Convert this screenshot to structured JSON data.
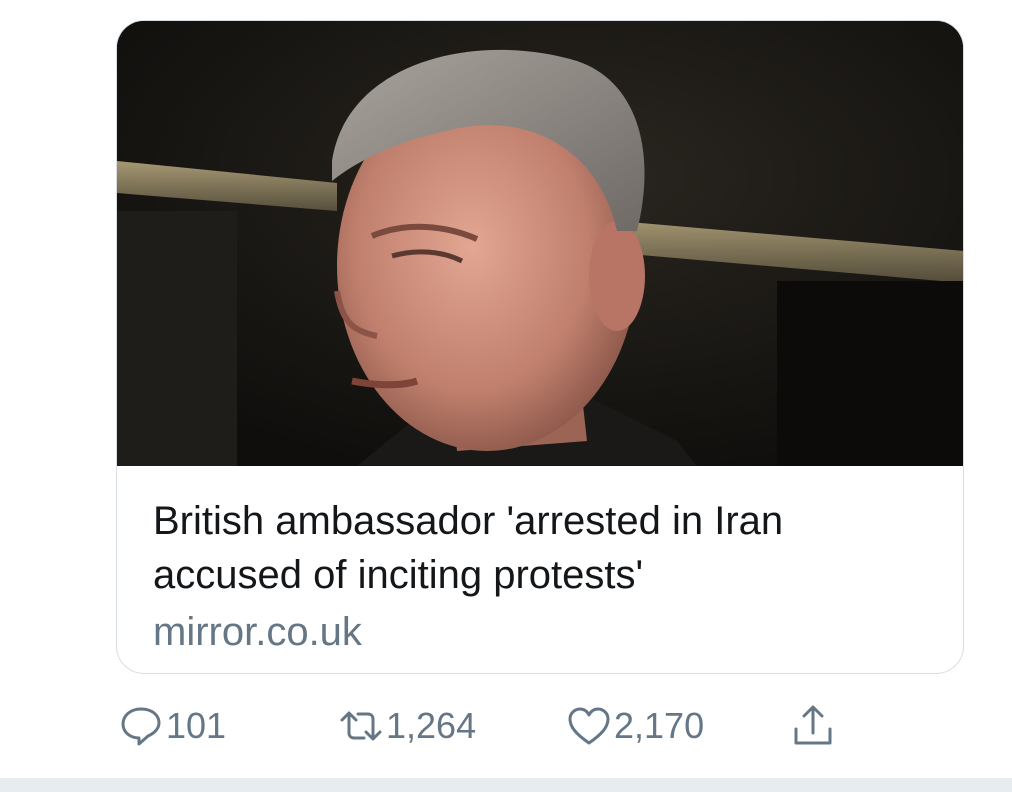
{
  "card": {
    "title": "British ambassador 'arrested in Iran accused of inciting protests'",
    "domain": "mirror.co.uk"
  },
  "actions": {
    "reply": {
      "icon": "reply-icon",
      "count": "101"
    },
    "retweet": {
      "icon": "retweet-icon",
      "count": "1,264"
    },
    "like": {
      "icon": "heart-icon",
      "count": "2,170"
    },
    "share": {
      "icon": "share-icon"
    }
  },
  "colors": {
    "title": "#14171a",
    "secondary": "#657786",
    "border": "#d6dde3",
    "divider": "#e6ecf0"
  }
}
